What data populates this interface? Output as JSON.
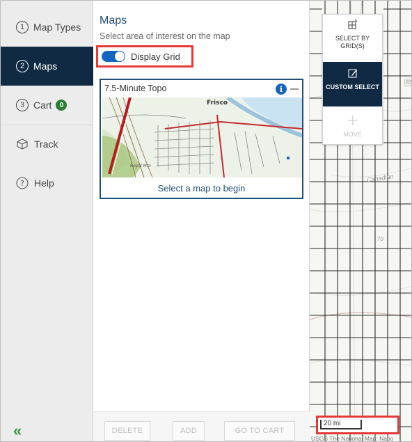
{
  "nav": {
    "items": [
      {
        "num": "1",
        "label": "Map Types"
      },
      {
        "num": "2",
        "label": "Maps"
      },
      {
        "num": "3",
        "label": "Cart",
        "badge": "0"
      },
      {
        "label": "Track",
        "icon": "cube-icon"
      },
      {
        "label": "Help",
        "icon": "question-icon"
      }
    ],
    "active_index": 1,
    "collapse_glyph": "«"
  },
  "panel": {
    "title": "Maps",
    "subtitle": "Select area of interest on the map",
    "grid_toggle": {
      "label": "Display Grid",
      "on": true
    },
    "card": {
      "title": "7.5-Minute Topo",
      "cta": "Select a map to begin",
      "thumb_labels": [
        "Frisco",
        "Royal Mtn"
      ]
    },
    "footer": {
      "delete_label": "DELETE",
      "add_label": "ADD",
      "go_to_cart_label": "GO TO CART"
    }
  },
  "map": {
    "tools": {
      "select_by_grid": "SELECT BY GRID(S)",
      "custom_select": "CUSTOM SELECT",
      "move": "MOVE"
    },
    "scale_label": "20 mi",
    "attribution": "USGS The National Map: Natio",
    "labels": {
      "canadian": "Canadian",
      "route_83": "83",
      "route_70": "70"
    }
  },
  "colors": {
    "nav_active": "#102a43",
    "accent_blue": "#1565c0",
    "highlight_red": "#e53935",
    "badge_green": "#2e7d32"
  }
}
